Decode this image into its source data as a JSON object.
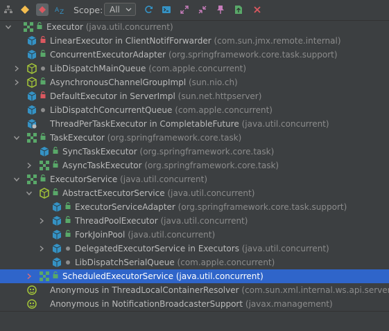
{
  "toolbar": {
    "scope_label": "Scope:",
    "scope_value": "All",
    "colors": {
      "accent_blue": "#3592c4",
      "green": "#59a869",
      "red": "#db5860",
      "yellow": "#f4bd4f",
      "pink": "#c77dbb"
    }
  },
  "tree": {
    "rows": [
      {
        "name": "Executor",
        "pkg": "(java.util.concurrent)"
      },
      {
        "name": "LinearExecutor in ClientNotifForwarder",
        "pkg": "(com.sun.jmx.remote.internal)"
      },
      {
        "name": "ConcurrentExecutorAdapter",
        "pkg": "(org.springframework.core.task.support)"
      },
      {
        "name": "LibDispatchMainQueue",
        "pkg": "(com.apple.concurrent)"
      },
      {
        "name": "AsynchronousChannelGroupImpl",
        "pkg": "(sun.nio.ch)"
      },
      {
        "name": "DefaultExecutor in ServerImpl",
        "pkg": "(sun.net.httpserver)"
      },
      {
        "name": "LibDispatchConcurrentQueue",
        "pkg": "(com.apple.concurrent)"
      },
      {
        "name": "ThreadPerTaskExecutor in CompletableFuture",
        "pkg": "(java.util.concurrent)"
      },
      {
        "name": "TaskExecutor",
        "pkg": "(org.springframework.core.task)"
      },
      {
        "name": "SyncTaskExecutor",
        "pkg": "(org.springframework.core.task)"
      },
      {
        "name": "AsyncTaskExecutor",
        "pkg": "(org.springframework.core.task)"
      },
      {
        "name": "ExecutorService",
        "pkg": "(java.util.concurrent)"
      },
      {
        "name": "AbstractExecutorService",
        "pkg": "(java.util.concurrent)"
      },
      {
        "name": "ExecutorServiceAdapter",
        "pkg": "(org.springframework.core.task.support)"
      },
      {
        "name": "ThreadPoolExecutor",
        "pkg": "(java.util.concurrent)"
      },
      {
        "name": "ForkJoinPool",
        "pkg": "(java.util.concurrent)"
      },
      {
        "name": "DelegatedExecutorService in Executors",
        "pkg": "(java.util.concurrent)"
      },
      {
        "name": "LibDispatchSerialQueue",
        "pkg": "(com.apple.concurrent)"
      },
      {
        "name": "ScheduledExecutorService",
        "pkg": "(java.util.concurrent)"
      },
      {
        "name": "Anonymous in ThreadLocalContainerResolver",
        "pkg": "(com.sun.xml.internal.ws.api.server)"
      },
      {
        "name": "Anonymous in NotificationBroadcasterSupport",
        "pkg": "(javax.management)"
      }
    ]
  }
}
